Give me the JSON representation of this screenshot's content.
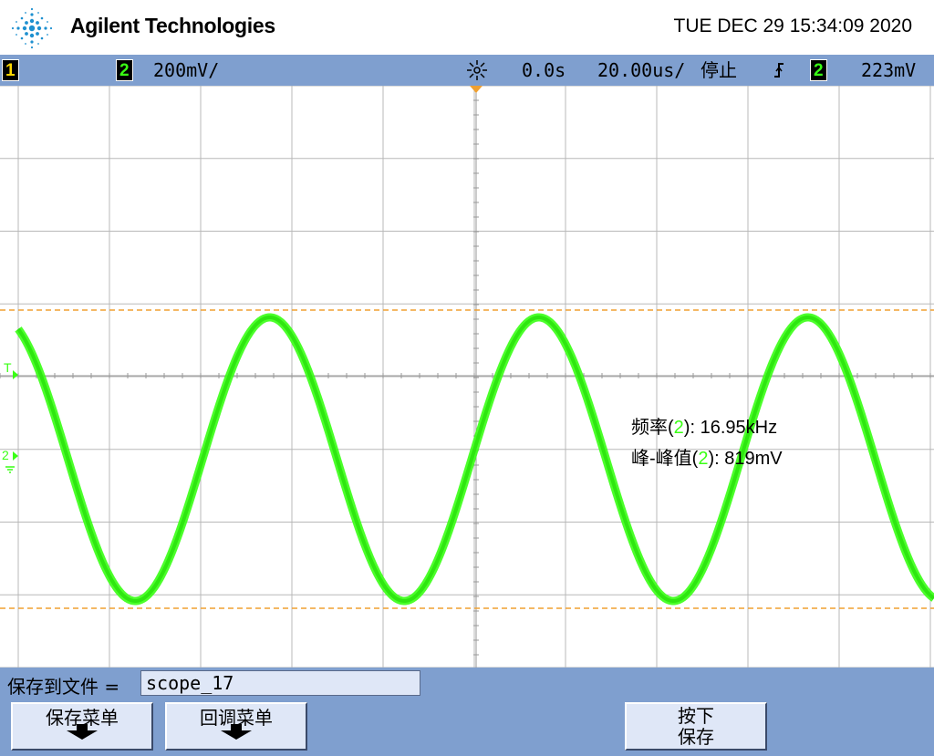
{
  "header": {
    "brand": "Agilent Technologies",
    "datetime": "TUE DEC 29 15:34:09 2020"
  },
  "status": {
    "ch1_label": "1",
    "ch2_label": "2",
    "ch2_scale": "200mV/",
    "trigger_delay": "0.0s",
    "timebase": "20.00us/",
    "run_state": "停止",
    "trigger_source": "2",
    "trigger_level": "223mV"
  },
  "markers": {
    "trigger_marker": "T",
    "ch2_marker": "2"
  },
  "measurements": {
    "freq_label": "频率(",
    "freq_ch": "2",
    "freq_value": "): 16.95kHz",
    "pp_label": "峰-峰值(",
    "pp_ch": "2",
    "pp_value": "): 819mV"
  },
  "waveform": {
    "channel": "2",
    "color": "#39ff14",
    "cursor_color": "#f0a030",
    "frequency_khz": 16.95,
    "vpp_mv": 819
  },
  "bottom": {
    "save_label": "保存到文件 =",
    "filename": "scope_17",
    "softkeys": [
      {
        "label": "保存菜单"
      },
      {
        "label": "回调菜单"
      },
      {
        "label": "按下"
      },
      {
        "label": "保存"
      }
    ]
  },
  "colors": {
    "bar": "#7f9fcf",
    "trace": "#39ff14",
    "cursor": "#f0a030"
  }
}
